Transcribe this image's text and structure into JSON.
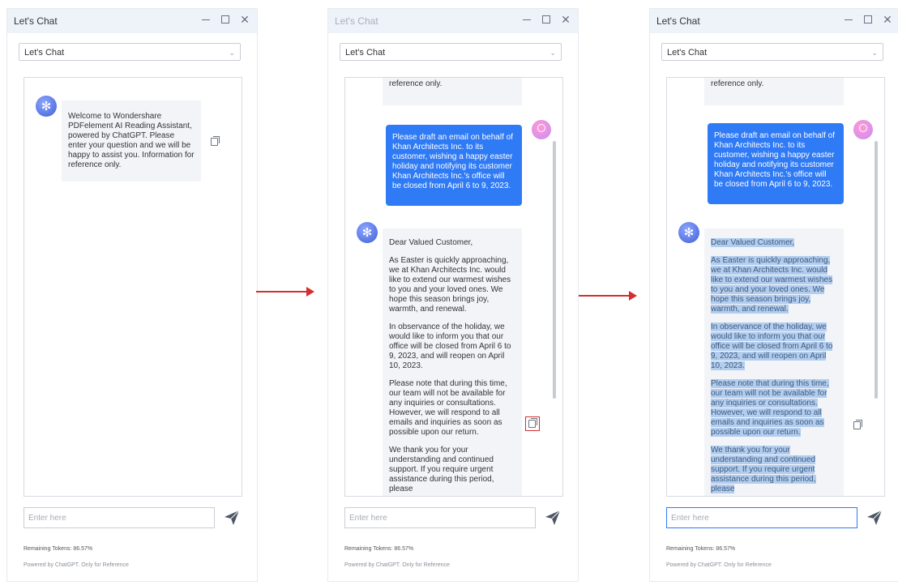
{
  "windows": [
    {
      "title": "Let's Chat",
      "dropdown": "Let's Chat",
      "bot_messages": [
        "Welcome to Wondershare PDFelement AI Reading Assistant, powered by ChatGPT. Please enter your question and we will be happy to assist you. Information for reference only."
      ],
      "input_placeholder": "Enter here",
      "remaining_tokens": "Remaining Tokens: 86.57%",
      "powered_by": "Powered by ChatGPT. Only for Reference"
    },
    {
      "title": "Let's Chat",
      "dropdown": "Let's Chat",
      "prev_tail": "reference only.",
      "user_message": "Please draft an email on behalf of Khan Architects Inc. to its customer, wishing a happy easter holiday and notifying its customer Khan Architects Inc.'s office will be closed from April 6 to 9, 2023.",
      "reply_paragraphs": [
        "Dear Valued Customer,",
        "As Easter is quickly approaching, we at Khan Architects Inc. would like to extend our warmest wishes to you and your loved ones. We hope this season brings joy, warmth, and renewal.",
        "In observance of the holiday, we would like to inform you that our office will be closed from April 6 to 9, 2023, and will reopen on April 10, 2023.",
        "Please note that during this time, our team will not be available for any inquiries or consultations. However, we will respond to all emails and inquiries as soon as possible upon our return.",
        "We thank you for your understanding and continued support. If you require urgent assistance during this period, please"
      ],
      "input_placeholder": "Enter here",
      "remaining_tokens": "Remaining Tokens: 86.57%",
      "powered_by": "Powered by ChatGPT. Only for Reference"
    },
    {
      "title": "Let's Chat",
      "dropdown": "Let's Chat",
      "prev_tail": "reference only.",
      "user_message": "Please draft an email on behalf of Khan Architects Inc. to its customer, wishing a happy easter holiday and notifying its customer Khan Architects Inc.'s office will be closed from April 6 to 9, 2023.",
      "reply_paragraphs": [
        "Dear Valued Customer,",
        "As Easter is quickly approaching, we at Khan Architects Inc. would like to extend our warmest wishes to you and your loved ones. We hope this season brings joy, warmth, and renewal.",
        "In observance of the holiday, we would like to inform you that our office will be closed from April 6 to 9, 2023, and will reopen on April 10, 2023.",
        "Please note that during this time, our team will not be available for any inquiries or consultations. However, we will respond to all emails and inquiries as soon as possible upon our return.",
        "We thank you for your understanding and continued support. If you require urgent assistance during this period, please"
      ],
      "input_placeholder": "Enter here",
      "remaining_tokens": "Remaining Tokens: 86.57%",
      "powered_by": "Powered by ChatGPT. Only for Reference"
    }
  ],
  "colors": {
    "user_bubble": "#2f7af5",
    "bot_bubble": "#f2f4f8",
    "selection": "#b3cdef",
    "annotation_red": "#d32f2f"
  },
  "icons": [
    "chatbot-avatar-icon",
    "user-avatar-icon",
    "copy-icon",
    "send-icon",
    "minimize-icon",
    "maximize-icon",
    "close-icon",
    "chevron-down-icon"
  ]
}
